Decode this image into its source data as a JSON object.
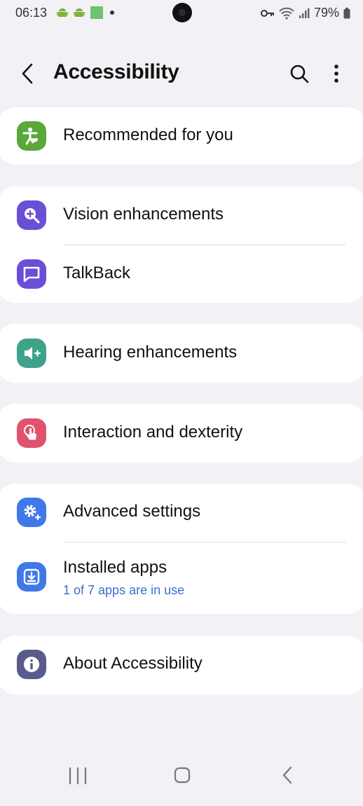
{
  "status": {
    "time": "06:13",
    "battery": "79%",
    "left_icons": [
      "android-icon",
      "android-icon",
      "image-icon",
      "dot-icon"
    ],
    "right_icons": [
      "key-icon",
      "wifi-icon",
      "signal-icon",
      "battery-icon"
    ]
  },
  "header": {
    "title": "Accessibility",
    "back_icon": "chevron-left-icon",
    "search_icon": "search-icon",
    "more_icon": "more-vertical-icon"
  },
  "sections": [
    {
      "items": [
        {
          "label": "Recommended for you",
          "icon": "accessibility-person-icon",
          "color": "#5aa73a"
        }
      ]
    },
    {
      "items": [
        {
          "label": "Vision enhancements",
          "icon": "zoom-in-icon",
          "color": "#6a4fd6"
        },
        {
          "label": "TalkBack",
          "icon": "talkback-icon",
          "color": "#6a4fd6"
        }
      ]
    },
    {
      "items": [
        {
          "label": "Hearing enhancements",
          "icon": "hearing-icon",
          "color": "#3fa38b"
        }
      ]
    },
    {
      "items": [
        {
          "label": "Interaction and dexterity",
          "icon": "touch-icon",
          "color": "#e0526e"
        }
      ]
    },
    {
      "items": [
        {
          "label": "Advanced settings",
          "icon": "settings-plus-icon",
          "color": "#3f78e8"
        },
        {
          "label": "Installed apps",
          "sublabel": "1 of 7 apps are in use",
          "icon": "download-icon",
          "color": "#3f78e8"
        }
      ]
    },
    {
      "items": [
        {
          "label": "About Accessibility",
          "icon": "info-icon",
          "color": "#5b5a8c"
        }
      ]
    }
  ],
  "navbar": {
    "recent_icon": "recent-apps-icon",
    "home_icon": "home-icon",
    "back_icon": "back-icon"
  }
}
